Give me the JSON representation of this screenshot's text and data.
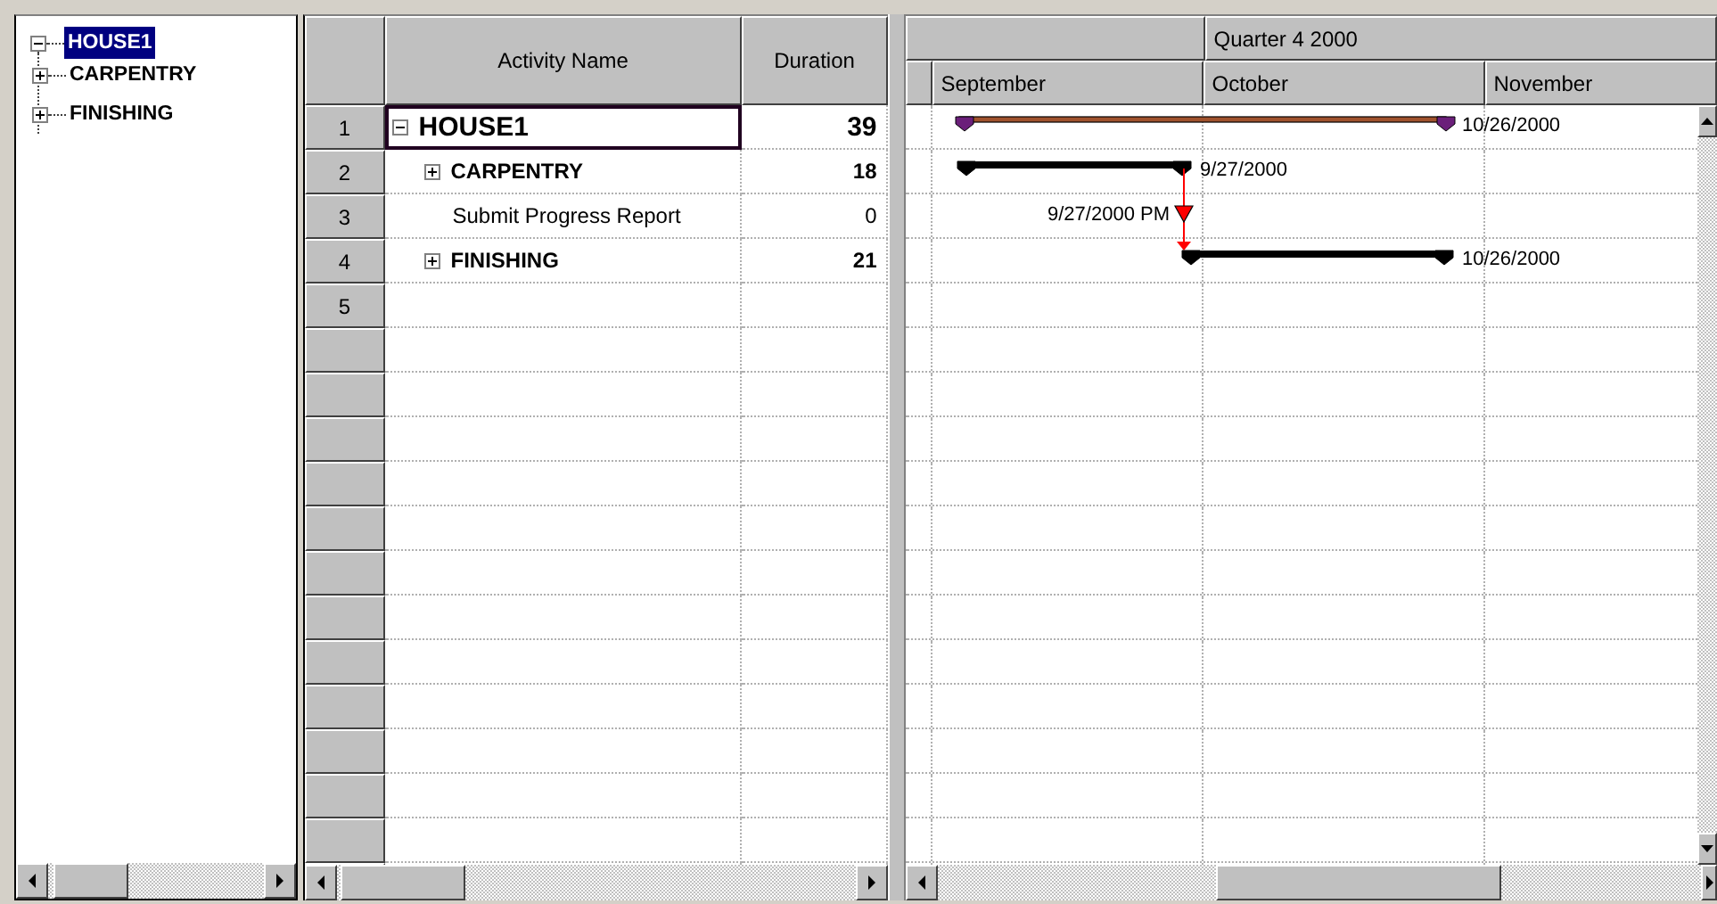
{
  "tree": {
    "items": [
      {
        "label": "HOUSE1",
        "selected": true,
        "expanded": true,
        "children": [
          {
            "label": "CARPENTRY",
            "selected": false,
            "expanded": false
          },
          {
            "label": "FINISHING",
            "selected": false,
            "expanded": false
          }
        ]
      }
    ]
  },
  "grid": {
    "columns": [
      {
        "label": "Activity Name"
      },
      {
        "label": "Duration"
      }
    ],
    "rows": [
      {
        "number": "1",
        "kind": "project",
        "name": "HOUSE1",
        "duration": "39",
        "expanded": true,
        "selected": true,
        "bar_label": "10/26/2000"
      },
      {
        "number": "2",
        "kind": "summary",
        "name": "CARPENTRY",
        "duration": "18",
        "expanded": false,
        "selected": false,
        "bar_label": "9/27/2000"
      },
      {
        "number": "3",
        "kind": "milestone",
        "name": "Submit Progress Report",
        "duration": "0",
        "selected": false,
        "bar_label": "9/27/2000 PM"
      },
      {
        "number": "4",
        "kind": "summary",
        "name": "FINISHING",
        "duration": "21",
        "expanded": false,
        "selected": false,
        "bar_label": "10/26/2000"
      },
      {
        "number": "5",
        "kind": "empty",
        "selected": false
      }
    ]
  },
  "timescale": {
    "quarter": "Quarter 4 2000",
    "months": [
      "September",
      "October",
      "November"
    ]
  }
}
